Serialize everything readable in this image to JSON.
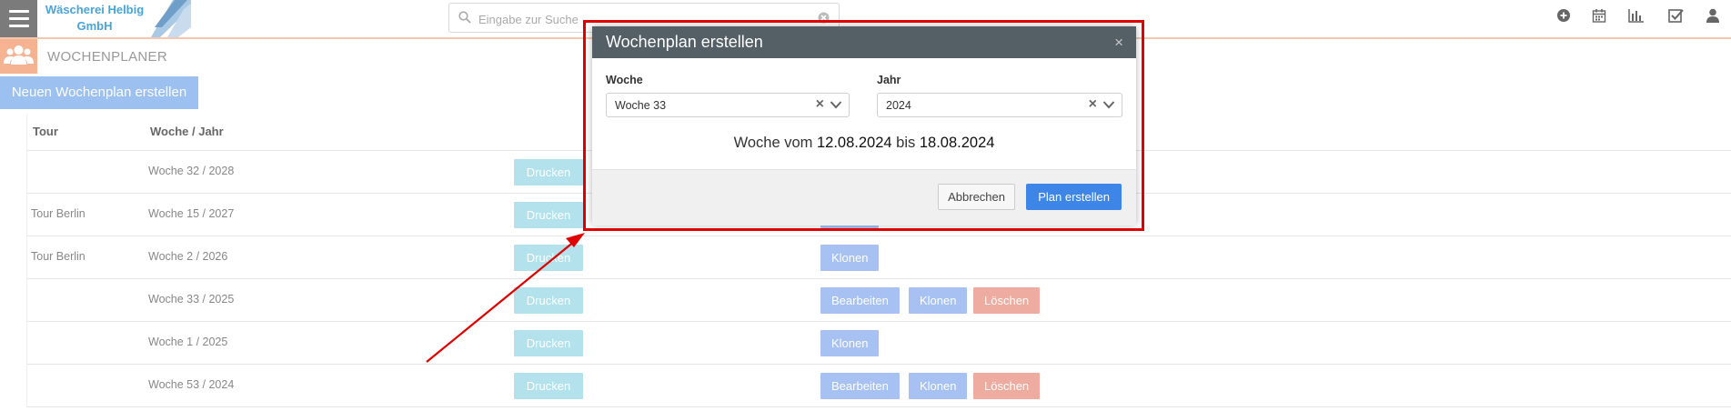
{
  "logo": {
    "line1": "Wäscherei Helbig",
    "line2": "GmbH"
  },
  "search": {
    "placeholder": "Eingabe zur Suche"
  },
  "section": {
    "title": "WOCHENPLANER"
  },
  "new_plan_button": "Neuen Wochenplan erstellen",
  "table": {
    "headers": {
      "tour": "Tour",
      "week_year": "Woche / Jahr"
    },
    "rows": [
      {
        "tour": "",
        "week": "Woche 32 / 2028"
      },
      {
        "tour": "Tour Berlin",
        "week": "Woche 15 / 2027"
      },
      {
        "tour": "Tour Berlin",
        "week": "Woche 2 / 2026"
      },
      {
        "tour": "",
        "week": "Woche 33 / 2025"
      },
      {
        "tour": "",
        "week": "Woche 1 / 2025"
      },
      {
        "tour": "",
        "week": "Woche 53 / 2024"
      }
    ],
    "buttons": {
      "print": "Drucken",
      "edit": "Bearbeiten",
      "clone": "Klonen",
      "delete": "Löschen"
    }
  },
  "modal": {
    "title": "Wochenplan erstellen",
    "close": "×",
    "week_label": "Woche",
    "week_value": "Woche 33",
    "year_label": "Jahr",
    "year_value": "2024",
    "range_prefix": "Woche vom",
    "range_start": "12.08.2024",
    "range_mid": "bis",
    "range_end": "18.08.2024",
    "cancel": "Abbrechen",
    "create": "Plan erstellen"
  },
  "colors": {
    "accent": "#3d86e8",
    "annotation": "#e00000",
    "print_button": "#b3e1ec",
    "action_button": "#a6c1f2",
    "delete_button": "#eeab9f"
  }
}
